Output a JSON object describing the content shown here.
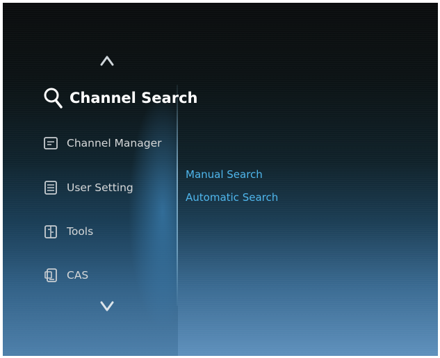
{
  "menu": {
    "items": [
      {
        "label": "Channel Search",
        "icon": "search-icon",
        "active": true
      },
      {
        "label": "Channel Manager",
        "icon": "channel-manager-icon"
      },
      {
        "label": "User Setting",
        "icon": "user-setting-icon"
      },
      {
        "label": "Tools",
        "icon": "tools-icon"
      },
      {
        "label": "CAS",
        "icon": "cas-card-icon"
      }
    ]
  },
  "submenu": {
    "items": [
      {
        "label": "Manual Search"
      },
      {
        "label": "Automatic Search"
      }
    ]
  },
  "colors": {
    "submenu_text": "#4fb6ec",
    "menu_text": "#d6d8d9",
    "active_text": "#ffffff"
  }
}
